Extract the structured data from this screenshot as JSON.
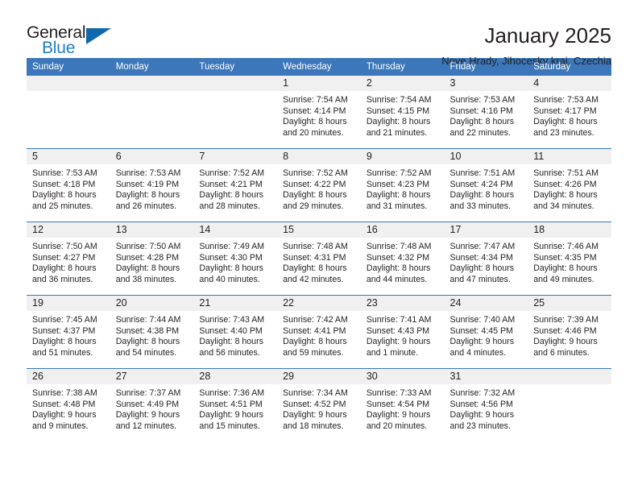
{
  "brand": {
    "word_general": "General",
    "word_blue": "Blue"
  },
  "header": {
    "month_title": "January 2025",
    "location": "Nove Hrady, Jihocesky kraj, Czechia"
  },
  "colors": {
    "header_blue": "#3b77ba",
    "logo_blue": "#1f7fc4",
    "logo_triangle": "#1268ad",
    "daynum_strip": "#f0f0f0",
    "text": "#231f20"
  },
  "weekday_headers": [
    "Sunday",
    "Monday",
    "Tuesday",
    "Wednesday",
    "Thursday",
    "Friday",
    "Saturday"
  ],
  "weeks": [
    [
      {
        "day": "",
        "lines": []
      },
      {
        "day": "",
        "lines": []
      },
      {
        "day": "",
        "lines": []
      },
      {
        "day": "1",
        "lines": [
          "Sunrise: 7:54 AM",
          "Sunset: 4:14 PM",
          "Daylight: 8 hours",
          "and 20 minutes."
        ]
      },
      {
        "day": "2",
        "lines": [
          "Sunrise: 7:54 AM",
          "Sunset: 4:15 PM",
          "Daylight: 8 hours",
          "and 21 minutes."
        ]
      },
      {
        "day": "3",
        "lines": [
          "Sunrise: 7:53 AM",
          "Sunset: 4:16 PM",
          "Daylight: 8 hours",
          "and 22 minutes."
        ]
      },
      {
        "day": "4",
        "lines": [
          "Sunrise: 7:53 AM",
          "Sunset: 4:17 PM",
          "Daylight: 8 hours",
          "and 23 minutes."
        ]
      }
    ],
    [
      {
        "day": "5",
        "lines": [
          "Sunrise: 7:53 AM",
          "Sunset: 4:18 PM",
          "Daylight: 8 hours",
          "and 25 minutes."
        ]
      },
      {
        "day": "6",
        "lines": [
          "Sunrise: 7:53 AM",
          "Sunset: 4:19 PM",
          "Daylight: 8 hours",
          "and 26 minutes."
        ]
      },
      {
        "day": "7",
        "lines": [
          "Sunrise: 7:52 AM",
          "Sunset: 4:21 PM",
          "Daylight: 8 hours",
          "and 28 minutes."
        ]
      },
      {
        "day": "8",
        "lines": [
          "Sunrise: 7:52 AM",
          "Sunset: 4:22 PM",
          "Daylight: 8 hours",
          "and 29 minutes."
        ]
      },
      {
        "day": "9",
        "lines": [
          "Sunrise: 7:52 AM",
          "Sunset: 4:23 PM",
          "Daylight: 8 hours",
          "and 31 minutes."
        ]
      },
      {
        "day": "10",
        "lines": [
          "Sunrise: 7:51 AM",
          "Sunset: 4:24 PM",
          "Daylight: 8 hours",
          "and 33 minutes."
        ]
      },
      {
        "day": "11",
        "lines": [
          "Sunrise: 7:51 AM",
          "Sunset: 4:26 PM",
          "Daylight: 8 hours",
          "and 34 minutes."
        ]
      }
    ],
    [
      {
        "day": "12",
        "lines": [
          "Sunrise: 7:50 AM",
          "Sunset: 4:27 PM",
          "Daylight: 8 hours",
          "and 36 minutes."
        ]
      },
      {
        "day": "13",
        "lines": [
          "Sunrise: 7:50 AM",
          "Sunset: 4:28 PM",
          "Daylight: 8 hours",
          "and 38 minutes."
        ]
      },
      {
        "day": "14",
        "lines": [
          "Sunrise: 7:49 AM",
          "Sunset: 4:30 PM",
          "Daylight: 8 hours",
          "and 40 minutes."
        ]
      },
      {
        "day": "15",
        "lines": [
          "Sunrise: 7:48 AM",
          "Sunset: 4:31 PM",
          "Daylight: 8 hours",
          "and 42 minutes."
        ]
      },
      {
        "day": "16",
        "lines": [
          "Sunrise: 7:48 AM",
          "Sunset: 4:32 PM",
          "Daylight: 8 hours",
          "and 44 minutes."
        ]
      },
      {
        "day": "17",
        "lines": [
          "Sunrise: 7:47 AM",
          "Sunset: 4:34 PM",
          "Daylight: 8 hours",
          "and 47 minutes."
        ]
      },
      {
        "day": "18",
        "lines": [
          "Sunrise: 7:46 AM",
          "Sunset: 4:35 PM",
          "Daylight: 8 hours",
          "and 49 minutes."
        ]
      }
    ],
    [
      {
        "day": "19",
        "lines": [
          "Sunrise: 7:45 AM",
          "Sunset: 4:37 PM",
          "Daylight: 8 hours",
          "and 51 minutes."
        ]
      },
      {
        "day": "20",
        "lines": [
          "Sunrise: 7:44 AM",
          "Sunset: 4:38 PM",
          "Daylight: 8 hours",
          "and 54 minutes."
        ]
      },
      {
        "day": "21",
        "lines": [
          "Sunrise: 7:43 AM",
          "Sunset: 4:40 PM",
          "Daylight: 8 hours",
          "and 56 minutes."
        ]
      },
      {
        "day": "22",
        "lines": [
          "Sunrise: 7:42 AM",
          "Sunset: 4:41 PM",
          "Daylight: 8 hours",
          "and 59 minutes."
        ]
      },
      {
        "day": "23",
        "lines": [
          "Sunrise: 7:41 AM",
          "Sunset: 4:43 PM",
          "Daylight: 9 hours",
          "and 1 minute."
        ]
      },
      {
        "day": "24",
        "lines": [
          "Sunrise: 7:40 AM",
          "Sunset: 4:45 PM",
          "Daylight: 9 hours",
          "and 4 minutes."
        ]
      },
      {
        "day": "25",
        "lines": [
          "Sunrise: 7:39 AM",
          "Sunset: 4:46 PM",
          "Daylight: 9 hours",
          "and 6 minutes."
        ]
      }
    ],
    [
      {
        "day": "26",
        "lines": [
          "Sunrise: 7:38 AM",
          "Sunset: 4:48 PM",
          "Daylight: 9 hours",
          "and 9 minutes."
        ]
      },
      {
        "day": "27",
        "lines": [
          "Sunrise: 7:37 AM",
          "Sunset: 4:49 PM",
          "Daylight: 9 hours",
          "and 12 minutes."
        ]
      },
      {
        "day": "28",
        "lines": [
          "Sunrise: 7:36 AM",
          "Sunset: 4:51 PM",
          "Daylight: 9 hours",
          "and 15 minutes."
        ]
      },
      {
        "day": "29",
        "lines": [
          "Sunrise: 7:34 AM",
          "Sunset: 4:52 PM",
          "Daylight: 9 hours",
          "and 18 minutes."
        ]
      },
      {
        "day": "30",
        "lines": [
          "Sunrise: 7:33 AM",
          "Sunset: 4:54 PM",
          "Daylight: 9 hours",
          "and 20 minutes."
        ]
      },
      {
        "day": "31",
        "lines": [
          "Sunrise: 7:32 AM",
          "Sunset: 4:56 PM",
          "Daylight: 9 hours",
          "and 23 minutes."
        ]
      },
      {
        "day": "",
        "lines": []
      }
    ]
  ]
}
